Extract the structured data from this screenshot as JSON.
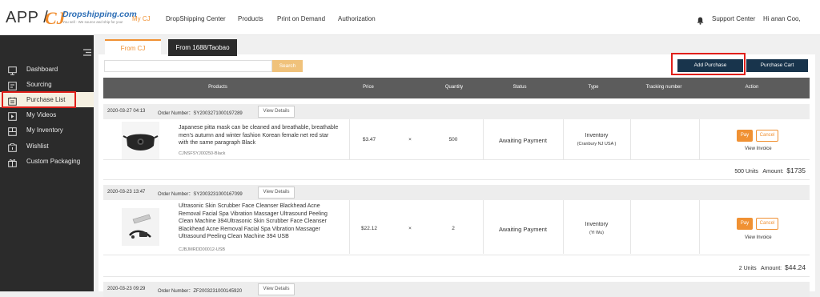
{
  "brand": {
    "app": "APP /",
    "logo_mark": "CJ",
    "logo_name": "Dropshipping.com",
    "logo_tagline": "You sell · We source and ship for you!"
  },
  "nav": [
    "My CJ",
    "DropShipping Center",
    "Products",
    "Print on Demand",
    "Authorization"
  ],
  "header": {
    "support": "Support Center",
    "user": "Hi anan Coo,"
  },
  "sidebar": [
    {
      "label": "Dashboard",
      "icon": "dashboard-icon"
    },
    {
      "label": "Sourcing",
      "icon": "sourcing-icon"
    },
    {
      "label": "Purchase List",
      "icon": "purchase-list-icon"
    },
    {
      "label": "My Videos",
      "icon": "video-icon"
    },
    {
      "label": "My Inventory",
      "icon": "inventory-icon"
    },
    {
      "label": "Wishlist",
      "icon": "wishlist-icon"
    },
    {
      "label": "Custom Packaging",
      "icon": "gift-icon"
    }
  ],
  "tabs": [
    "From CJ",
    "From 1688/Taobao"
  ],
  "search": {
    "placeholder": "",
    "button": "Search"
  },
  "actions": {
    "add_purchase": "Add Purchase",
    "purchase_cart": "Purchase Cart"
  },
  "columns": [
    "Products",
    "Price",
    "Quantity",
    "Status",
    "Type",
    "Tracking number",
    "Action"
  ],
  "orders": [
    {
      "date": "2020-03-27 04:13",
      "order_number": "Order Number：SY2003271000197289",
      "view": "View Details",
      "description": "Japanese pitta mask can be cleaned and breathable, breathable men's autumn and winter fashion Korean female net red star with the same paragraph Black",
      "sku": "CJNSFSYJ00250-Black",
      "price": "$3.47",
      "times": "×",
      "quantity": "500",
      "status": "Awaiting Payment",
      "type": "Inventory",
      "location": "(Cranbury NJ USA )",
      "pay": "Pay",
      "cancel": "Cancel",
      "invoice": "View Invoice",
      "units": "500 Units",
      "amount_label": "Amount:",
      "amount": "$1735"
    },
    {
      "date": "2020-03-23 13:47",
      "order_number": "Order Number：SY2003231000167099",
      "view": "View Details",
      "description": "Ultrasonic Skin Scrubber Face Cleanser Blackhead Acne Removal Facial Spa Vibration Massager Ultrasound Peeling Clean Machine 394Ultrasonic Skin Scrubber Face Cleanser Blackhead Acne Removal Facial Spa Vibration Massager Ultrasound Peeling Clean Machine 394 USB",
      "sku": "CJBJMRDD00012-USB",
      "price": "$22.12",
      "times": "×",
      "quantity": "2",
      "status": "Awaiting Payment",
      "type": "Inventory",
      "location": "(Yi Wu)",
      "pay": "Pay",
      "cancel": "Cancel",
      "invoice": "View Invoice",
      "units": "2 Units",
      "amount_label": "Amount:",
      "amount": "$44.24"
    },
    {
      "date": "2020-03-23 09:29",
      "order_number": "Order Number：ZF2003231000145920",
      "view": "View Details"
    }
  ],
  "colors": {
    "accent": "#f09133",
    "dark": "#2b2b2b",
    "navy": "#18344c",
    "highlight": "#e0201b"
  }
}
